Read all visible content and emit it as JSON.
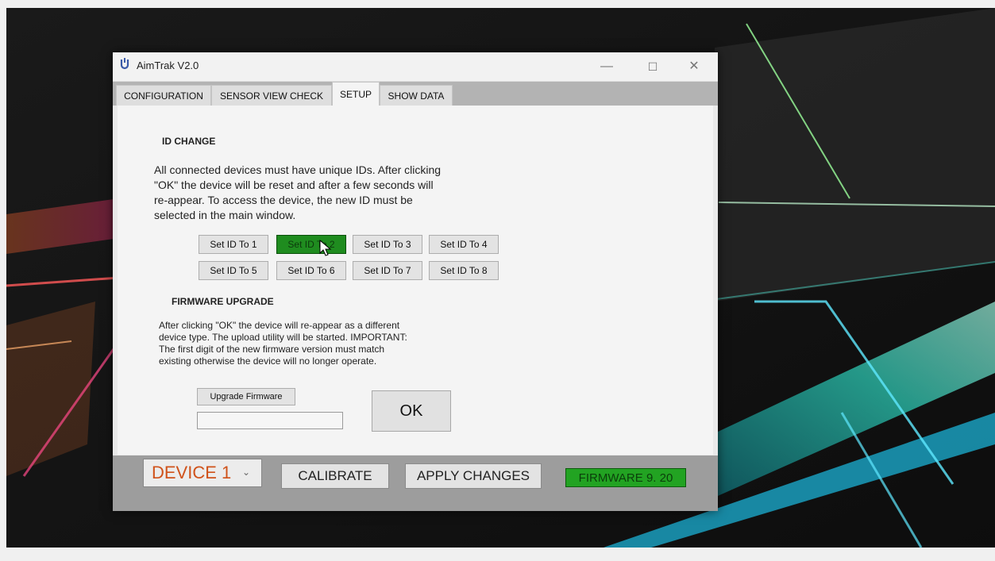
{
  "window": {
    "title": "AimTrak V2.0",
    "controls": {
      "minimize": "—",
      "maximize": "☐",
      "close": "✕"
    }
  },
  "tabs": [
    {
      "label": "CONFIGURATION"
    },
    {
      "label": "SENSOR VIEW CHECK"
    },
    {
      "label": "SETUP",
      "active": true
    },
    {
      "label": "SHOW DATA"
    }
  ],
  "id_change": {
    "title": "ID CHANGE",
    "description": "All connected devices must have unique IDs. After clicking\n\"OK\" the device will be reset and after a few seconds will\nre-appear. To access the device, the new ID must be\nselected in the main window.",
    "buttons": [
      {
        "label": "Set ID To 1"
      },
      {
        "label": "Set ID To 2",
        "selected": true
      },
      {
        "label": "Set ID To 3"
      },
      {
        "label": "Set ID To 4"
      },
      {
        "label": "Set ID To 5"
      },
      {
        "label": "Set ID To 6"
      },
      {
        "label": "Set ID To 7"
      },
      {
        "label": "Set ID To 8"
      }
    ]
  },
  "firmware_upgrade": {
    "title": "FIRMWARE UPGRADE",
    "description": "After clicking \"OK\" the device will re-appear as a different\ndevice type. The upload utility will be started. IMPORTANT:\nThe first digit of the new firmware version must match\nexisting otherwise the device will no longer operate.",
    "upgrade_button": "Upgrade Firmware",
    "progress_value": ""
  },
  "ok_button": "OK",
  "bottom_bar": {
    "device_select": "DEVICE 1",
    "calibrate": "CALIBRATE",
    "apply_changes": "APPLY CHANGES",
    "firmware_badge": "FIRMWARE 9. 20"
  },
  "colors": {
    "selected_button": "#1f8c1f",
    "firmware_badge": "#22a322",
    "device_text": "#d0521a"
  }
}
